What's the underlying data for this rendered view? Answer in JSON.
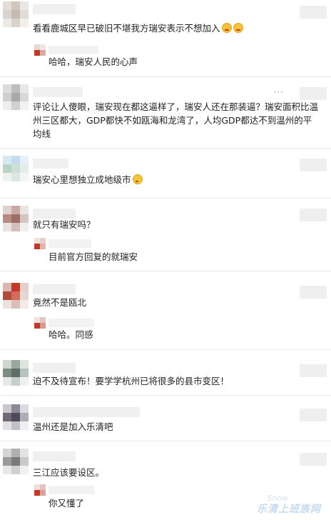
{
  "comments": [
    {
      "text": "看看鹿城区早已破旧不堪我方瑞安表示不想加入",
      "emoji": [
        "grimace-emoji",
        "grimace-emoji"
      ],
      "reply": {
        "text": "哈哈，瑞安人民的心声"
      }
    },
    {
      "text": "评论让人傻眼，瑞安现在都这逼样了，瑞安人还在那装逼？瑞安面积比温州三区都大，GDP都快不如瓯海和龙湾了，人均GDP都达不到温州的平均线"
    },
    {
      "text": "瑞安心里想独立成地级市",
      "emoji": [
        "thinking-emoji"
      ]
    },
    {
      "text": "就只有瑞安吗？",
      "reply": {
        "text": "目前官方回复的就瑞安"
      }
    },
    {
      "text": "竟然不是瓯北",
      "reply": {
        "text": "哈哈。同感"
      }
    },
    {
      "text": "迫不及待宣布！要学学杭州已将很多的县市变区！"
    },
    {
      "text": "温州还是加入乐清吧"
    },
    {
      "text": "三江应该要设区。",
      "reply": {
        "text": "你又懂了"
      }
    }
  ],
  "watermark": {
    "text": "乐清上班族网",
    "logo": "Snow"
  },
  "colors": {
    "avatar_red": "#c0392b",
    "blur_gray": "#d9d9d9",
    "emoji_yellow": "#f5c33b"
  }
}
